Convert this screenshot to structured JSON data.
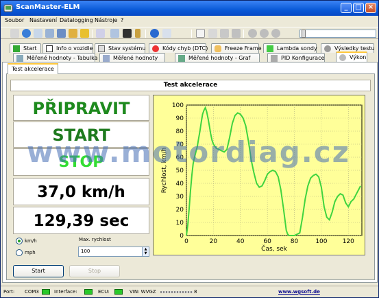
{
  "window": {
    "title": "ScanMaster-ELM"
  },
  "menu": [
    "Soubor",
    "Nastavení",
    "Datalogging",
    "Nástroje",
    "?"
  ],
  "tabs_row1": [
    {
      "label": "Start",
      "icon": "flag-icon"
    },
    {
      "label": "Info o vozidle",
      "icon": "info-icon"
    },
    {
      "label": "Stav systému",
      "icon": "clipboard-icon"
    },
    {
      "label": "Kódy chyb (DTC)",
      "icon": "warning-icon"
    },
    {
      "label": "Freeze Frame",
      "icon": "hand-icon"
    },
    {
      "label": "Lambda sondy",
      "icon": "sensor-icon"
    },
    {
      "label": "Výsledky testu",
      "icon": "gear-icon"
    }
  ],
  "tabs_row2": [
    {
      "label": "Měřené hodnoty - Tabulka",
      "icon": "table-icon"
    },
    {
      "label": "Měřené hodnoty",
      "icon": "gauge-icon"
    },
    {
      "label": "Měřené hodnoty - Graf",
      "icon": "chart-icon"
    },
    {
      "label": "PID Konfigurace",
      "icon": "config-icon"
    },
    {
      "label": "Výkon",
      "icon": "speedometer-icon"
    }
  ],
  "subtab": "Test akcelerace",
  "section_title": "Test akcelerace",
  "readouts": {
    "prepare": "PŘIPRAVIT",
    "start": "START",
    "stop": "STOP",
    "speed": "37,0 km/h",
    "time": "129,39 sec"
  },
  "units": {
    "kmh": "km/h",
    "mph": "mph",
    "selected": "km/h"
  },
  "max_speed": {
    "label": "Max. rychlost",
    "value": "100"
  },
  "buttons": {
    "start": "Start",
    "stop": "Stop"
  },
  "watermark": "www.motordiag.cz",
  "status": {
    "port_label": "Port:",
    "port_value": "COM3",
    "interface_label": "Interface:",
    "ecu_label": "ECU:",
    "vin_label": "VIN: WVGZ",
    "vin_suffix": "8",
    "website": "www.wgsoft.de"
  },
  "colors": {
    "line": "#3fd43f",
    "plot_bg": "#ffff99",
    "accent_green": "#1e8a1e"
  },
  "chart_data": {
    "type": "line",
    "xlabel": "Čas, sek",
    "ylabel": "Rychlost, km/h",
    "xlim": [
      0,
      130
    ],
    "ylim": [
      0,
      100
    ],
    "xticks": [
      0,
      20,
      40,
      60,
      80,
      100,
      120
    ],
    "yticks": [
      0,
      10,
      20,
      30,
      40,
      50,
      60,
      70,
      80,
      90,
      100
    ],
    "grid": true,
    "series": [
      {
        "x": [
          0,
          1,
          2,
          3,
          4,
          5,
          6,
          7,
          8,
          9,
          10,
          11,
          12,
          13,
          14,
          15,
          16,
          17,
          18,
          19,
          20,
          22,
          24,
          26,
          28,
          30,
          32,
          34,
          36,
          38,
          40,
          42,
          44,
          46,
          48,
          50,
          52,
          54,
          56,
          58,
          60,
          62,
          64,
          66,
          68,
          70,
          72,
          74,
          75,
          76,
          78,
          80,
          82,
          84,
          86,
          88,
          90,
          92,
          94,
          96,
          98,
          100,
          102,
          104,
          106,
          108,
          110,
          112,
          114,
          116,
          118,
          120,
          122,
          124,
          126,
          128,
          129
        ],
        "y": [
          0,
          8,
          20,
          34,
          46,
          55,
          60,
          64,
          68,
          74,
          80,
          87,
          93,
          96,
          98,
          95,
          90,
          84,
          78,
          73,
          70,
          67,
          66,
          65,
          64,
          66,
          75,
          86,
          92,
          94,
          93,
          90,
          84,
          72,
          58,
          48,
          40,
          37,
          38,
          42,
          47,
          49,
          50,
          49,
          45,
          35,
          20,
          4,
          1,
          0,
          0,
          0,
          1,
          2,
          14,
          28,
          38,
          44,
          46,
          47,
          45,
          37,
          22,
          14,
          12,
          18,
          26,
          30,
          32,
          31,
          25,
          22,
          26,
          28,
          32,
          36,
          38
        ]
      }
    ]
  }
}
